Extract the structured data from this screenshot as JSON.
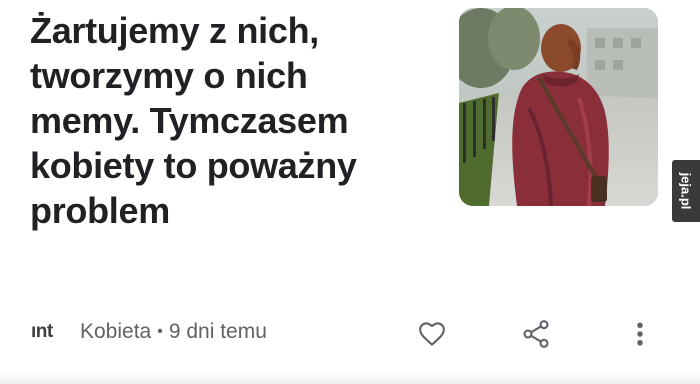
{
  "article": {
    "title_lines": [
      "Żartujemy z nich,",
      "tworzymy o nich",
      "memy. Tymczasem",
      "kobiety to poważny",
      "problem"
    ],
    "thumbnail_icon": "woman-photo"
  },
  "footer": {
    "source_logo": "ınt",
    "category": "Kobieta",
    "separator": "•",
    "time_ago": "9 dni temu",
    "like_icon": "heart-icon",
    "share_icon": "share-icon",
    "more_icon": "more-vert-icon"
  },
  "watermark": {
    "text": "jeja.pl",
    "icon": "jeja-logo"
  },
  "colors": {
    "text": "#202124",
    "meta": "#5f6368",
    "icon": "#5f6368",
    "sweater": "#8a2f3a"
  }
}
